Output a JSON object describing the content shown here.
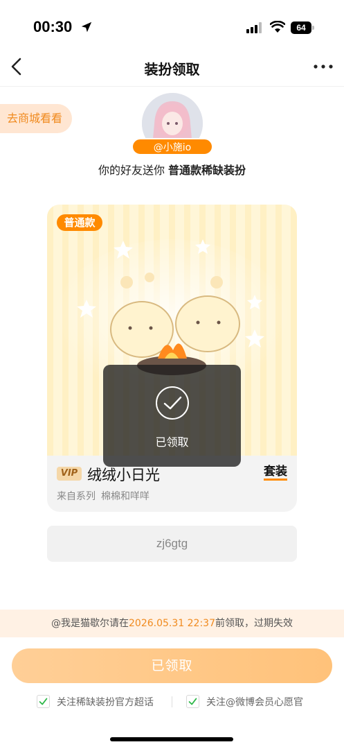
{
  "status_bar": {
    "time": "00:30",
    "battery": "64"
  },
  "nav": {
    "title": "装扮领取"
  },
  "mall_link": "去商城看看",
  "sender": {
    "name": "@小施io",
    "gift_text_prefix": "你的好友送你 ",
    "gift_text_bold": "普通款稀缺装扮"
  },
  "card": {
    "tier_badge": "普通款",
    "vip_badge": "VIP",
    "item_name": "绒绒小日光",
    "suit_label": "套装",
    "series_label": "来自系列",
    "series_name": "棉棉和咩咩"
  },
  "redeem_code": "zj6gtg",
  "toast": {
    "text": "已领取"
  },
  "notice": {
    "prefix": "@我是猫歇尔请在",
    "deadline": "2026.05.31 22:37",
    "suffix": "前领取，过期失效"
  },
  "claim_button": "已领取",
  "follow": [
    {
      "label": "关注稀缺装扮官方超话",
      "checked": true
    },
    {
      "label": "关注@微博会员心愿官",
      "checked": true
    }
  ],
  "colors": {
    "accent": "#ff8a00",
    "card_bg": "#fff6d8"
  }
}
